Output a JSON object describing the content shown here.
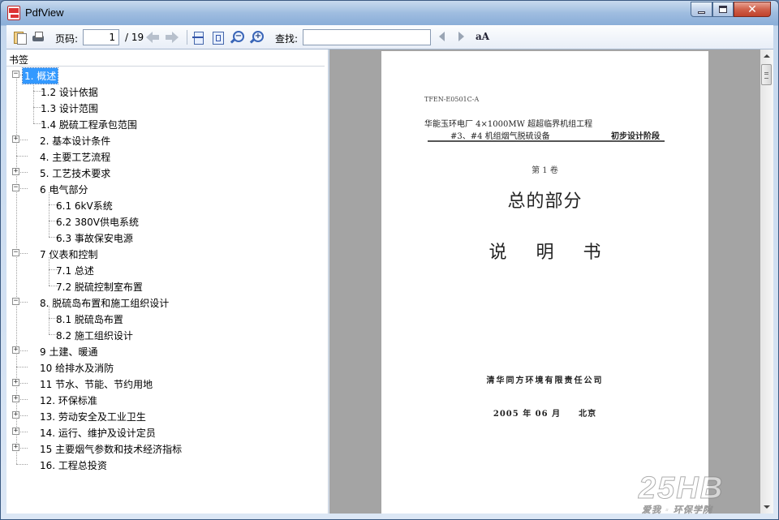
{
  "window": {
    "title": "PdfView"
  },
  "toolbar": {
    "page_label": "页码:",
    "page_value": "1",
    "page_total": "/ 19",
    "find_label": "查找:",
    "find_value": "",
    "case_icon_text": "aA",
    "icons": [
      "open-file-icon",
      "print-icon",
      "prev-page-icon",
      "next-page-icon",
      "fit-width-icon",
      "fit-page-icon",
      "zoom-out-icon",
      "zoom-in-icon",
      "find-prev-icon",
      "find-next-icon",
      "match-case-icon"
    ]
  },
  "sidebar": {
    "title": "书签",
    "items": [
      {
        "label": "1. 概述",
        "expander": "⊟",
        "selected": true
      },
      {
        "label": "1.2 设计依据"
      },
      {
        "label": "1.3 设计范围"
      },
      {
        "label": "1.4 脱硫工程承包范围"
      },
      {
        "label": "2. 基本设计条件",
        "expander": "+"
      },
      {
        "label": "4. 主要工艺流程"
      },
      {
        "label": "5. 工艺技术要求",
        "expander": "+"
      },
      {
        "label": "6 电气部分",
        "expander": "−"
      },
      {
        "label": "6.1 6kV系统"
      },
      {
        "label": "6.2 380V供电系统"
      },
      {
        "label": "6.3 事故保安电源"
      },
      {
        "label": "7 仪表和控制",
        "expander": "−"
      },
      {
        "label": "7.1 总述"
      },
      {
        "label": "7.2 脱硫控制室布置"
      },
      {
        "label": "8. 脱硫岛布置和施工组织设计",
        "expander": "−"
      },
      {
        "label": "8.1 脱硫岛布置"
      },
      {
        "label": "8.2 施工组织设计"
      },
      {
        "label": "9 土建、暖通",
        "expander": "+"
      },
      {
        "label": "10 给排水及消防"
      },
      {
        "label": "11 节水、节能、节约用地",
        "expander": "+"
      },
      {
        "label": "12. 环保标准",
        "expander": "+"
      },
      {
        "label": "13. 劳动安全及工业卫生",
        "expander": "+"
      },
      {
        "label": "14. 运行、维护及设计定员",
        "expander": "+"
      },
      {
        "label": "15 主要烟气参数和技术经济指标",
        "expander": "+"
      },
      {
        "label": "16. 工程总投资"
      }
    ]
  },
  "document": {
    "code": "TFEN-E0501C-A",
    "project_line1": "华能玉环电厂 4×1000MW 超超临界机组工程",
    "project_line2": "#3、#4 机组烟气脱硫设备",
    "phase": "初步设计阶段",
    "volume": "第 1 卷",
    "title": "总的部分",
    "subtitle": "说明书",
    "company": "清华同方环境有限责任公司",
    "date": "2005 年 06 月　　北京"
  },
  "watermark": {
    "logo": "25HB",
    "tagline": "爱我 · 环保学院"
  },
  "colors": {
    "selection": "#3399ff",
    "viewer_bg": "#a4a4a4"
  }
}
